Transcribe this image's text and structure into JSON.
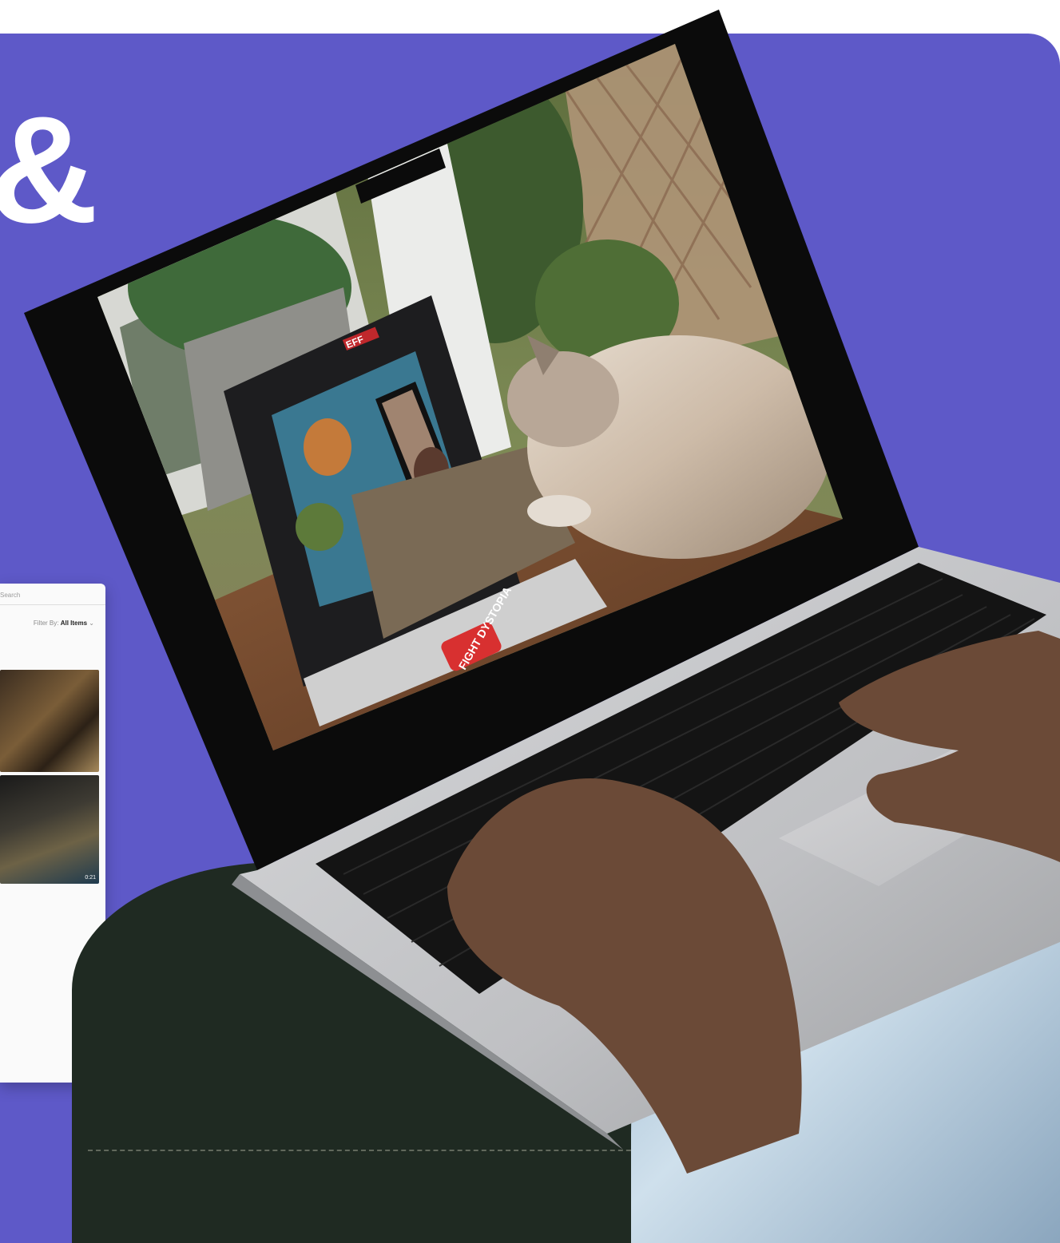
{
  "decoration": {
    "ampersand": "&"
  },
  "browser_window": {
    "search_placeholder": "Search",
    "filter_label": "Filter By:",
    "filter_value": "All Items",
    "thumbnails": [
      {
        "duration": ""
      },
      {
        "duration": "0:21"
      }
    ]
  },
  "screen_stickers": {
    "eff_logo": "EFF",
    "fight_sticker": "FIGHT DYSTOPIA"
  },
  "colors": {
    "background_panel": "#5e59c8",
    "laptop_body": "#c9cacc",
    "keyboard": "#141414"
  }
}
